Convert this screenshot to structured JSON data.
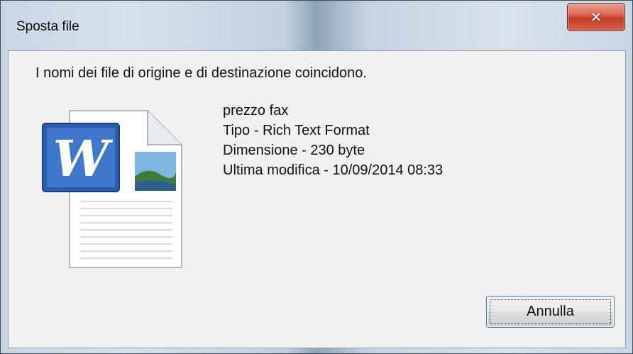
{
  "window": {
    "title": "Sposta file"
  },
  "titlebar": {
    "close_glyph": "✕",
    "close_icon": "close-icon"
  },
  "message": "I nomi dei file di origine e di destinazione coincidono.",
  "file": {
    "icon": "word-document-icon",
    "name": "prezzo fax",
    "type": "Tipo - Rich Text Format",
    "size": "Dimensione - 230 byte",
    "modified": "Ultima modifica - 10/09/2014 08:33"
  },
  "buttons": {
    "cancel_label": "Annulla"
  },
  "colors": {
    "close_red": "#c43c26",
    "dialog_bg": "#f0f0f0",
    "focus_border": "#3c7fb1",
    "word_blue": "#2a5db0"
  }
}
